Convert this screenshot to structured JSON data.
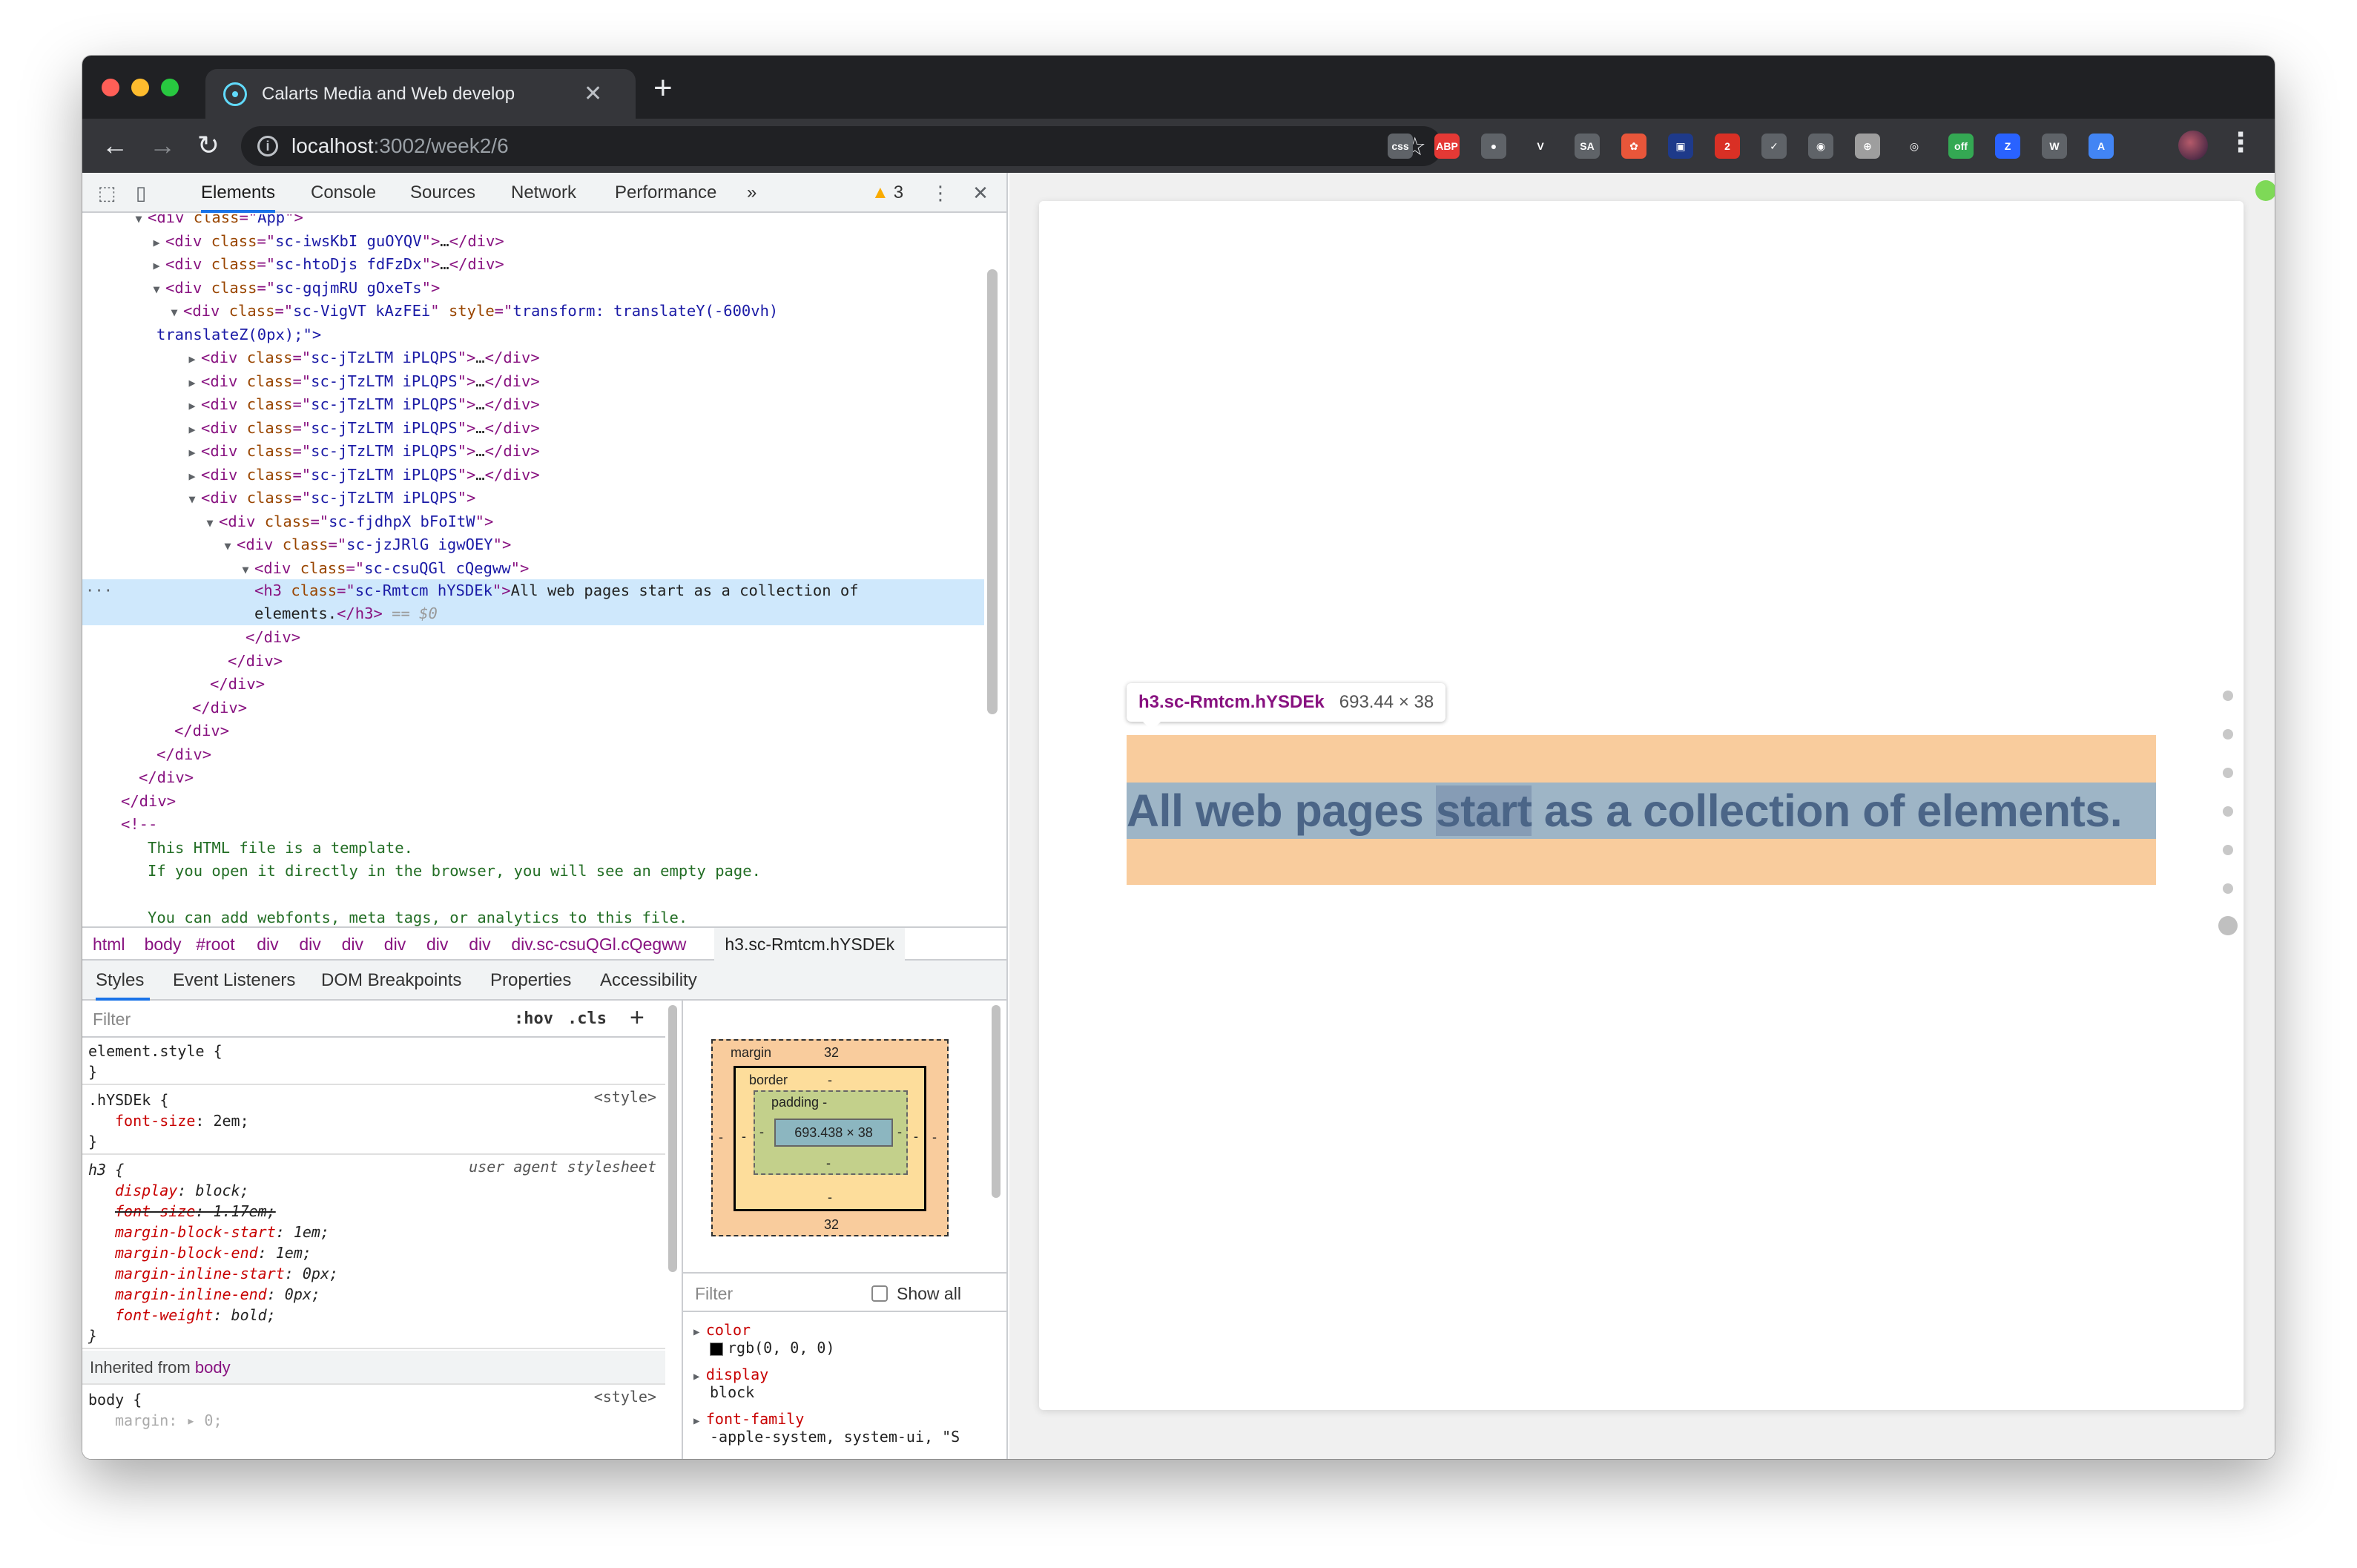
{
  "tab": {
    "title": "Calarts Media and Web develop"
  },
  "omnibox": {
    "host": "localhost",
    "path": ":3002/week2/6"
  },
  "devtools": {
    "tabs": [
      "Elements",
      "Console",
      "Sources",
      "Network",
      "Performance"
    ],
    "more": "»",
    "warnings": "3",
    "tree": [
      {
        "indent": 1,
        "arrow": "▼",
        "html": "<span class=\"tag\">&lt;div </span><span class=\"attr\">class</span><span class=\"tag\">=\"</span><span class=\"val\">App</span><span class=\"tag\">\"&gt;</span>"
      },
      {
        "indent": 2,
        "arrow": "▶",
        "tag": "div",
        "cls": "sc-iwsKbI guOYQV",
        "collapsed": true
      },
      {
        "indent": 2,
        "arrow": "▶",
        "tag": "div",
        "cls": "sc-htoDjs fdFzDx",
        "collapsed": true
      },
      {
        "indent": 2,
        "arrow": "▼",
        "tag": "div",
        "cls": "sc-gqjmRU gOxeTs",
        "collapsed": false
      },
      {
        "indent": 3,
        "arrow": "▼",
        "tag": "div",
        "cls": "sc-VigVT kAzFEi",
        "style": "transform: translateY(-600vh)",
        "collapsed": false
      },
      {
        "indent": 2.5,
        "text": "translateZ(0px);\">"
      },
      {
        "indent": 4,
        "arrow": "▶",
        "tag": "div",
        "cls": "sc-jTzLTM iPLQPS",
        "collapsed": true
      },
      {
        "indent": 4,
        "arrow": "▶",
        "tag": "div",
        "cls": "sc-jTzLTM iPLQPS",
        "collapsed": true
      },
      {
        "indent": 4,
        "arrow": "▶",
        "tag": "div",
        "cls": "sc-jTzLTM iPLQPS",
        "collapsed": true
      },
      {
        "indent": 4,
        "arrow": "▶",
        "tag": "div",
        "cls": "sc-jTzLTM iPLQPS",
        "collapsed": true
      },
      {
        "indent": 4,
        "arrow": "▶",
        "tag": "div",
        "cls": "sc-jTzLTM iPLQPS",
        "collapsed": true
      },
      {
        "indent": 4,
        "arrow": "▶",
        "tag": "div",
        "cls": "sc-jTzLTM iPLQPS",
        "collapsed": true
      },
      {
        "indent": 4,
        "arrow": "▼",
        "tag": "div",
        "cls": "sc-jTzLTM iPLQPS",
        "collapsed": false
      },
      {
        "indent": 5,
        "arrow": "▼",
        "tag": "div",
        "cls": "sc-fjdhpX bFoItW",
        "collapsed": false
      },
      {
        "indent": 6,
        "arrow": "▼",
        "tag": "div",
        "cls": "sc-jzJRlG igwOEY",
        "collapsed": false
      },
      {
        "indent": 7,
        "arrow": "▼",
        "tag": "div",
        "cls": "sc-csuQGl cQegww",
        "collapsed": false
      },
      {
        "selected": true,
        "indent": 8
      },
      {
        "indent": 7.5,
        "close": "div"
      },
      {
        "indent": 6.5,
        "close": "div"
      },
      {
        "indent": 5.5,
        "close": "div"
      },
      {
        "indent": 4.5,
        "close": "div"
      },
      {
        "indent": 3.5,
        "close": "div"
      },
      {
        "indent": 2.5,
        "close": "div"
      },
      {
        "indent": 1.5,
        "close": "div"
      },
      {
        "indent": 0.5,
        "close": "div"
      },
      {
        "indent": 0.5,
        "open": "<!--"
      },
      {
        "indent": 2,
        "comment": "This HTML file is a template."
      },
      {
        "indent": 2,
        "comment": "If you open it directly in the browser, you will see an empty page."
      },
      {
        "indent": 2,
        "comment": ""
      },
      {
        "indent": 2,
        "comment": "You can add webfonts, meta tags, or analytics to this file."
      }
    ],
    "selected_node": {
      "tag": "h3",
      "cls": "sc-Rmtcm hYSDEk",
      "text": "All web pages start as a collection of",
      "text2": "elements.",
      "marker": "== $0"
    },
    "breadcrumb": [
      "html",
      "body",
      "#root",
      "div",
      "div",
      "div",
      "div",
      "div",
      "div",
      "div.sc-csuQGl.cQegww",
      "h3.sc-Rmtcm.hYSDEk"
    ],
    "style_tabs": [
      "Styles",
      "Event Listeners",
      "DOM Breakpoints",
      "Properties",
      "Accessibility"
    ],
    "styles": {
      "filter_placeholder": "Filter",
      "hov": ":hov",
      "cls": ".cls",
      "plus": "+",
      "element_style": "element.style {",
      "close_brace": "}",
      "rule1_selector": ".hYSDEk {",
      "rule1_source": "<style>",
      "rule1_prop": "font-size",
      "rule1_val": "2em;",
      "rule2_selector": "h3 {",
      "rule2_source": "user agent stylesheet",
      "ua_props": [
        {
          "p": "display",
          "v": "block;",
          "strike": false
        },
        {
          "p": "font-size",
          "v": "1.17em;",
          "strike": true
        },
        {
          "p": "margin-block-start",
          "v": "1em;",
          "strike": false
        },
        {
          "p": "margin-block-end",
          "v": "1em;",
          "strike": false
        },
        {
          "p": "margin-inline-start",
          "v": "0px;",
          "strike": false
        },
        {
          "p": "margin-inline-end",
          "v": "0px;",
          "strike": false
        },
        {
          "p": "font-weight",
          "v": "bold;",
          "strike": false
        }
      ],
      "inherited_label": "Inherited from",
      "inherited_from": "body",
      "body_selector": "body {",
      "body_source": "<style>",
      "body_prop": "margin",
      "body_val": "0;"
    },
    "box_model": {
      "margin_label": "margin",
      "margin_top": "32",
      "margin_bottom": "32",
      "margin_side": "-",
      "border_label": "border",
      "border_val": "-",
      "padding_label": "padding -",
      "padding_val": "-",
      "content": "693.438 × 38"
    },
    "computed": {
      "filter_placeholder": "Filter",
      "show_all": "Show all",
      "props": [
        {
          "n": "color",
          "v": "rgb(0, 0, 0)",
          "swatch": true
        },
        {
          "n": "display",
          "v": "block",
          "swatch": false
        },
        {
          "n": "font-family",
          "v": "-apple-system, system-ui, \"S",
          "swatch": false
        }
      ]
    }
  },
  "page": {
    "tooltip_name": "h3.sc-Rmtcm.hYSDEk",
    "tooltip_dim": "693.44 × 38",
    "heading_before": "All web pages ",
    "heading_selected": "start",
    "heading_after": " as a collection of elements."
  },
  "extensions": [
    {
      "label": "css",
      "color": "#5f6368"
    },
    {
      "label": "ABP",
      "color": "#e53935"
    },
    {
      "label": "●",
      "color": "#5f6368"
    },
    {
      "label": "V",
      "color": "#35363a"
    },
    {
      "label": "SA",
      "color": "#5f6368"
    },
    {
      "label": "✿",
      "color": "#e8563a"
    },
    {
      "label": "▣",
      "color": "#1e3a8a"
    },
    {
      "label": "2",
      "color": "#d93025"
    },
    {
      "label": "✓",
      "color": "#5f6368"
    },
    {
      "label": "◉",
      "color": "#5f6368"
    },
    {
      "label": "⊕",
      "color": "#9e9e9e"
    },
    {
      "label": "◎",
      "color": "#35363a"
    },
    {
      "label": "off",
      "color": "#34a853"
    },
    {
      "label": "Z",
      "color": "#2962ff"
    },
    {
      "label": "W",
      "color": "#5f6368"
    },
    {
      "label": "A",
      "color": "#4285f4"
    }
  ]
}
